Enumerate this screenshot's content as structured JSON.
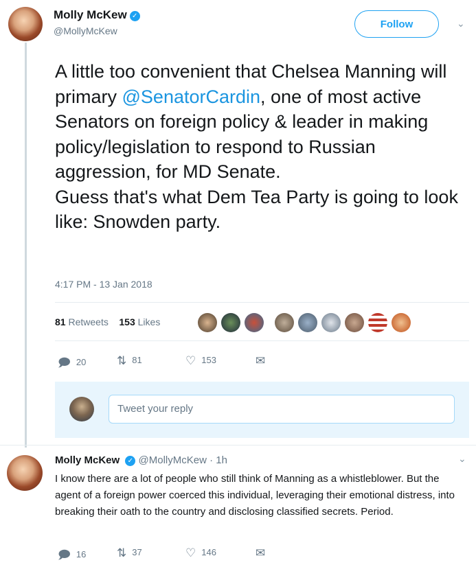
{
  "tweet": {
    "display_name": "Molly McKew",
    "handle": "@MollyMcKew",
    "follow_label": "Follow",
    "text_before_mention": "A little too convenient that Chelsea Manning will primary ",
    "mention": "@SenatorCardin",
    "text_after_mention": ", one of most active Senators on foreign policy & leader in making policy/legislation to respond to Russian aggression, for MD Senate.",
    "text_line2": "Guess that's what Dem Tea Party is going to look like: Snowden party.",
    "timestamp": "4:17 PM - 13 Jan 2018",
    "retweets_count": "81",
    "retweets_label": "Retweets",
    "likes_count": "153",
    "likes_label": "Likes",
    "actions": {
      "reply": "20",
      "retweet": "81",
      "like": "153"
    }
  },
  "reply_box": {
    "placeholder": "Tweet your reply"
  },
  "reply_tweet": {
    "display_name": "Molly McKew",
    "meta": "@MollyMcKew · 1h",
    "text": "I know there are a lot of people who still think of Manning as a whistleblower. But the agent of a foreign power coerced this individual, leveraging their emotional distress, into breaking their oath to the country and disclosing classified secrets. Period.",
    "actions": {
      "reply": "16",
      "retweet": "37",
      "like": "146"
    }
  },
  "icons": {
    "verified": "verified-badge-icon",
    "chevron": "chevron-down-icon",
    "reply": "reply-icon",
    "retweet": "retweet-icon",
    "like": "heart-icon",
    "message": "envelope-icon"
  },
  "colors": {
    "accent": "#1da1f2",
    "mention": "#1b95e0",
    "muted": "#657786"
  }
}
